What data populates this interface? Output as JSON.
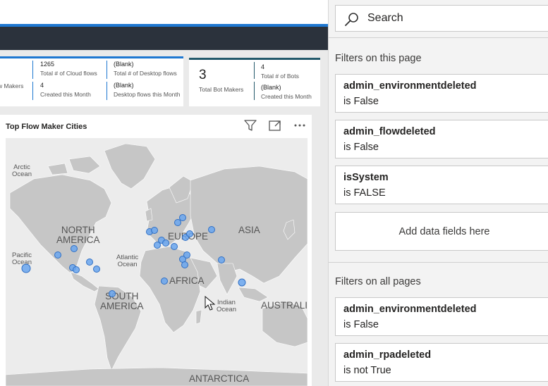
{
  "kpi_card_1": {
    "left_edge_label": "w Makers",
    "cloud_flows_value": "1265",
    "cloud_flows_label": "Total # of Cloud flows",
    "desktop_flows_value": "(Blank)",
    "desktop_flows_label": "Total # of Desktop flows",
    "created_month_value": "4",
    "created_month_label": "Created this Month",
    "desktop_created_value": "(Blank)",
    "desktop_created_label": "Desktop flows this Month"
  },
  "kpi_card_2": {
    "bot_makers_value": "3",
    "bot_makers_label": "Total Bot Makers",
    "bots_value": "4",
    "bots_label": "Total # of Bots",
    "bots_created_value": "(Blank)",
    "bots_created_label": "Created this Month"
  },
  "map_visual": {
    "title": "Top Flow Maker Cities",
    "icons": [
      "filter-icon",
      "focus-mode-icon",
      "more-options-icon"
    ],
    "labels": {
      "arctic_ocean": "Arctic\nOcean",
      "north_america": "NORTH\nAMERICA",
      "europe": "EUROPE",
      "asia": "ASIA",
      "pacific_ocean": "Pacific\nOcean",
      "atlantic_ocean": "Atlantic\nOcean",
      "africa": "AFRICA",
      "south_america": "SOUTH\nAMERICA",
      "indian_ocean": "Indian\nOcean",
      "australia": "AUSTRALI",
      "antarctica": "ANTARCTICA"
    },
    "colors": {
      "land": "#c6c6c6",
      "water": "#ececec",
      "bubble": "#6aa6ee",
      "bubble_stroke": "#2f6fc4"
    }
  },
  "filter_pane": {
    "search_placeholder": "Search",
    "page_section_title": "Filters on this page",
    "page_filters": [
      {
        "name": "admin_environmentdeleted",
        "value": "is False"
      },
      {
        "name": "admin_flowdeleted",
        "value": "is False"
      },
      {
        "name": "isSystem",
        "value": "is FALSE"
      }
    ],
    "add_fields_label": "Add data fields here",
    "all_section_title": "Filters on all pages",
    "all_filters": [
      {
        "name": "admin_environmentdeleted",
        "value": "is False"
      },
      {
        "name": "admin_rpadeleted",
        "value": "is not True"
      }
    ]
  }
}
